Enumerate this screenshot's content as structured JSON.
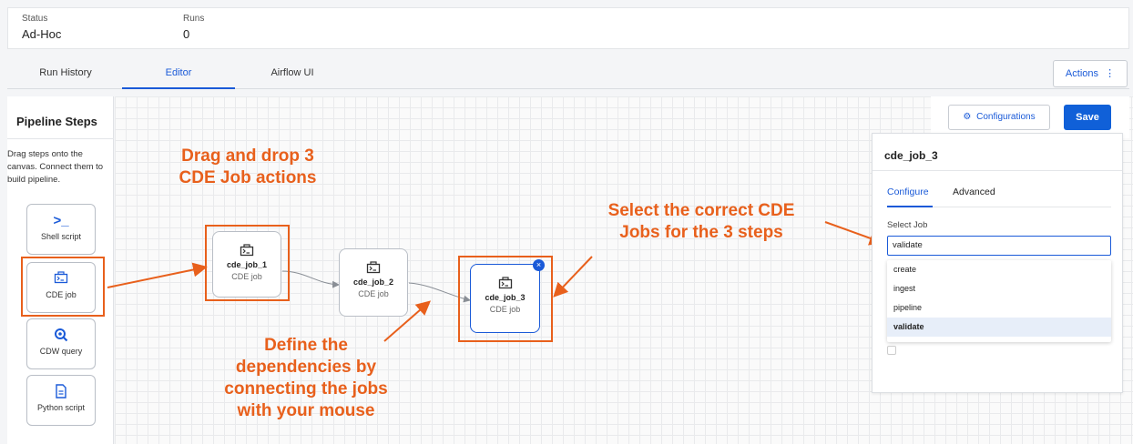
{
  "info": {
    "status_label": "Status",
    "status_value": "Ad-Hoc",
    "runs_label": "Runs",
    "runs_value": "0"
  },
  "tabs": [
    {
      "label": "Run History",
      "active": false
    },
    {
      "label": "Editor",
      "active": true
    },
    {
      "label": "Airflow UI",
      "active": false
    }
  ],
  "actions_label": "Actions",
  "actions_icon": "kebab-icon",
  "sidebar": {
    "title": "Pipeline Steps",
    "description": "Drag steps onto the canvas. Connect them to build pipeline.",
    "steps": [
      {
        "label": "Shell script",
        "icon": "terminal-icon"
      },
      {
        "label": "CDE job",
        "icon": "cde-job-icon"
      },
      {
        "label": "CDW query",
        "icon": "query-icon"
      },
      {
        "label": "Python script",
        "icon": "python-script-icon"
      }
    ]
  },
  "nodes": [
    {
      "name": "cde_job_1",
      "type": "CDE job"
    },
    {
      "name": "cde_job_2",
      "type": "CDE job"
    },
    {
      "name": "cde_job_3",
      "type": "CDE job"
    }
  ],
  "close_glyph": "×",
  "toolbar": {
    "configurations_label": "Configurations",
    "save_label": "Save"
  },
  "panel": {
    "title": "cde_job_3",
    "tabs": [
      "Configure",
      "Advanced"
    ],
    "select_label": "Select Job",
    "select_value": "validate",
    "options": [
      "create",
      "ingest",
      "pipeline",
      "validate"
    ]
  },
  "callouts": {
    "drag_line1": "Drag and drop 3",
    "drag_line2": "CDE Job actions",
    "select_line1": "Select the correct CDE",
    "select_line2": "Jobs for the 3 steps",
    "define_line1": "Define the",
    "define_line2": "dependencies by",
    "define_line3": "connecting the jobs",
    "define_line4": "with your mouse"
  },
  "colors": {
    "accent": "#1a5ad8",
    "callout": "#e8601c",
    "save": "#1060d8"
  }
}
